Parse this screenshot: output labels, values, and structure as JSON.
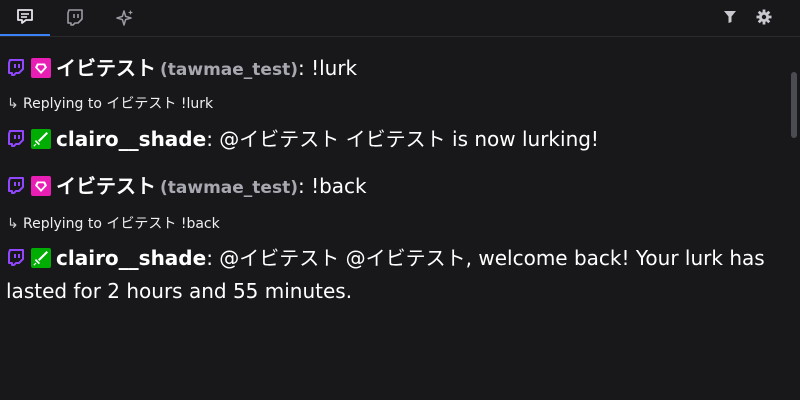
{
  "tabs": [
    {
      "name": "chat",
      "icon": "chat-bubble-icon",
      "active": true
    },
    {
      "name": "twitch",
      "icon": "twitch-icon",
      "active": false
    },
    {
      "name": "ai",
      "icon": "sparkle-icon",
      "active": false
    }
  ],
  "toolbar": {
    "filter_icon": "filter-icon",
    "settings_icon": "gear-icon"
  },
  "colors": {
    "background": "#18181b",
    "twitch_purple": "#9147ff",
    "sub_badge": "#e91eb4",
    "mod_badge": "#00ad03",
    "active_tab": "#3b82f6"
  },
  "messages": [
    {
      "type": "chat",
      "platform_icon": "twitch-icon",
      "badge_icon": "diamond-heart-icon",
      "display_name": "イビテスト",
      "login": "(tawmae_test)",
      "separator": ":",
      "text": " !lurk"
    },
    {
      "type": "reply-indicator",
      "prefix": "Replying to",
      "target": " イビテスト !lurk"
    },
    {
      "type": "chat",
      "platform_icon": "twitch-icon",
      "badge_icon": "sword-icon",
      "display_name": "clairo__shade",
      "separator": ":",
      "text": " @イビテスト イビテスト is now lurking!"
    },
    {
      "type": "chat",
      "platform_icon": "twitch-icon",
      "badge_icon": "diamond-heart-icon",
      "display_name": "イビテスト",
      "login": "(tawmae_test)",
      "separator": ":",
      "text": " !back"
    },
    {
      "type": "reply-indicator",
      "prefix": "Replying to",
      "target": " イビテスト !back"
    },
    {
      "type": "chat",
      "platform_icon": "twitch-icon",
      "badge_icon": "sword-icon",
      "display_name": "clairo__shade",
      "separator": ":",
      "text": " @イビテスト @イビテスト, welcome back! Your lurk has lasted for 2 hours and 55 minutes."
    }
  ]
}
